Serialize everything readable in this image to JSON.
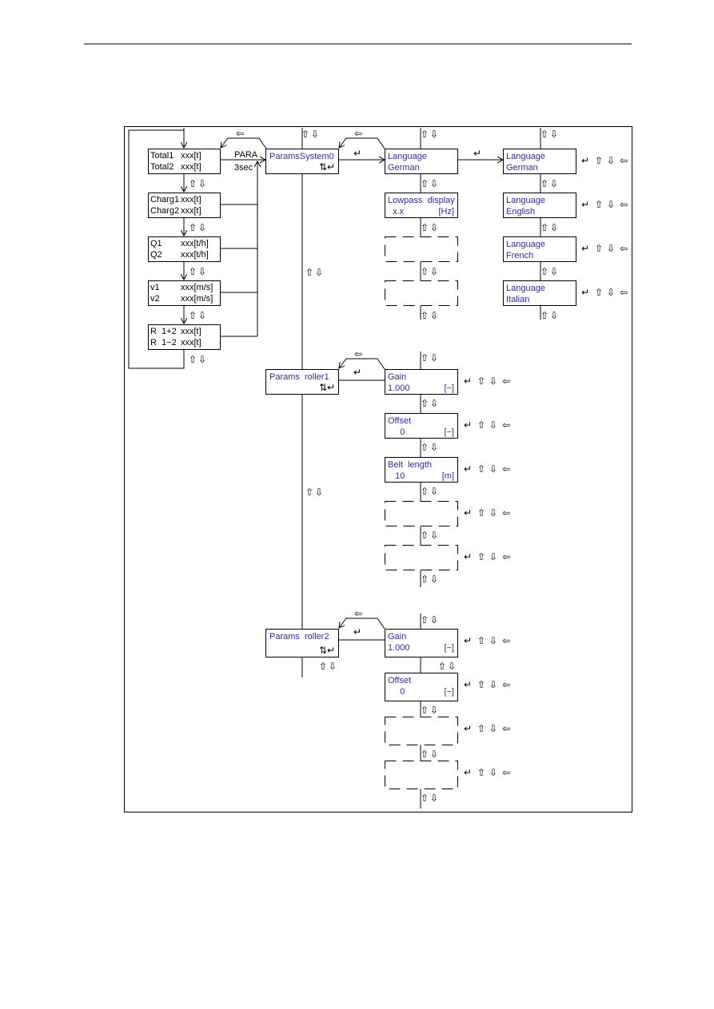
{
  "colors": {
    "lcd_text": "#2a2ab4",
    "static_text": "#000000",
    "lines": "#000000"
  },
  "icons": {
    "up": "up-arrow-icon",
    "down": "down-arrow-icon",
    "back": "left-arrow-icon",
    "enter": "enter-icon",
    "updown_enter": "up-down-enter-icon"
  },
  "glyphs": {
    "up": "⇧",
    "down": "⇩",
    "back": "⇦",
    "enter": "↵",
    "updown_enter": "⇅↵"
  },
  "main_display": {
    "para_label": "PARA",
    "hold_label": "3sec",
    "boxes": [
      {
        "l1": "Total1",
        "v1": "xxx[t]",
        "l2": "Total2",
        "v2": "xxx[t]"
      },
      {
        "l1": "Charg1",
        "v1": "xxx[t]",
        "l2": "Charg2",
        "v2": "xxx[t]"
      },
      {
        "l1": "Q1",
        "v1": "xxx[t/h]",
        "l2": "Q2",
        "v2": "xxx[t/h]"
      },
      {
        "l1": "v1",
        "v1": "xxx[m/s]",
        "l2": "v2",
        "v2": "xxx[m/s]"
      },
      {
        "l1": "R  1+2",
        "v1": "xxx[t]",
        "l2": "R  1−2",
        "v2": "xxx[t]"
      }
    ]
  },
  "menus": [
    {
      "title": "ParamsSystem0"
    },
    {
      "title": "Params  roller1"
    },
    {
      "title": "Params  roller2"
    }
  ],
  "system_params": [
    {
      "l1": "Language",
      "l2": "German",
      "u": ""
    },
    {
      "l1": "Lowpass  display",
      "l2": "  x.x",
      "u": "[Hz]"
    }
  ],
  "languages": [
    {
      "l1": "Language",
      "l2": "German"
    },
    {
      "l1": "Language",
      "l2": "English"
    },
    {
      "l1": "Language",
      "l2": "French"
    },
    {
      "l1": "Language",
      "l2": "Italian"
    }
  ],
  "roller1_params": [
    {
      "l1": "Gain",
      "l2": "1.000",
      "u": "[−]"
    },
    {
      "l1": "Offset",
      "l2": "     0",
      "u": "[−]"
    },
    {
      "l1": "Belt  length",
      "l2": "   10",
      "u": "[m]"
    }
  ],
  "roller2_params": [
    {
      "l1": "Gain",
      "l2": "1.000",
      "u": "[−]"
    },
    {
      "l1": "Offset",
      "l2": "     0",
      "u": "[−]"
    }
  ]
}
